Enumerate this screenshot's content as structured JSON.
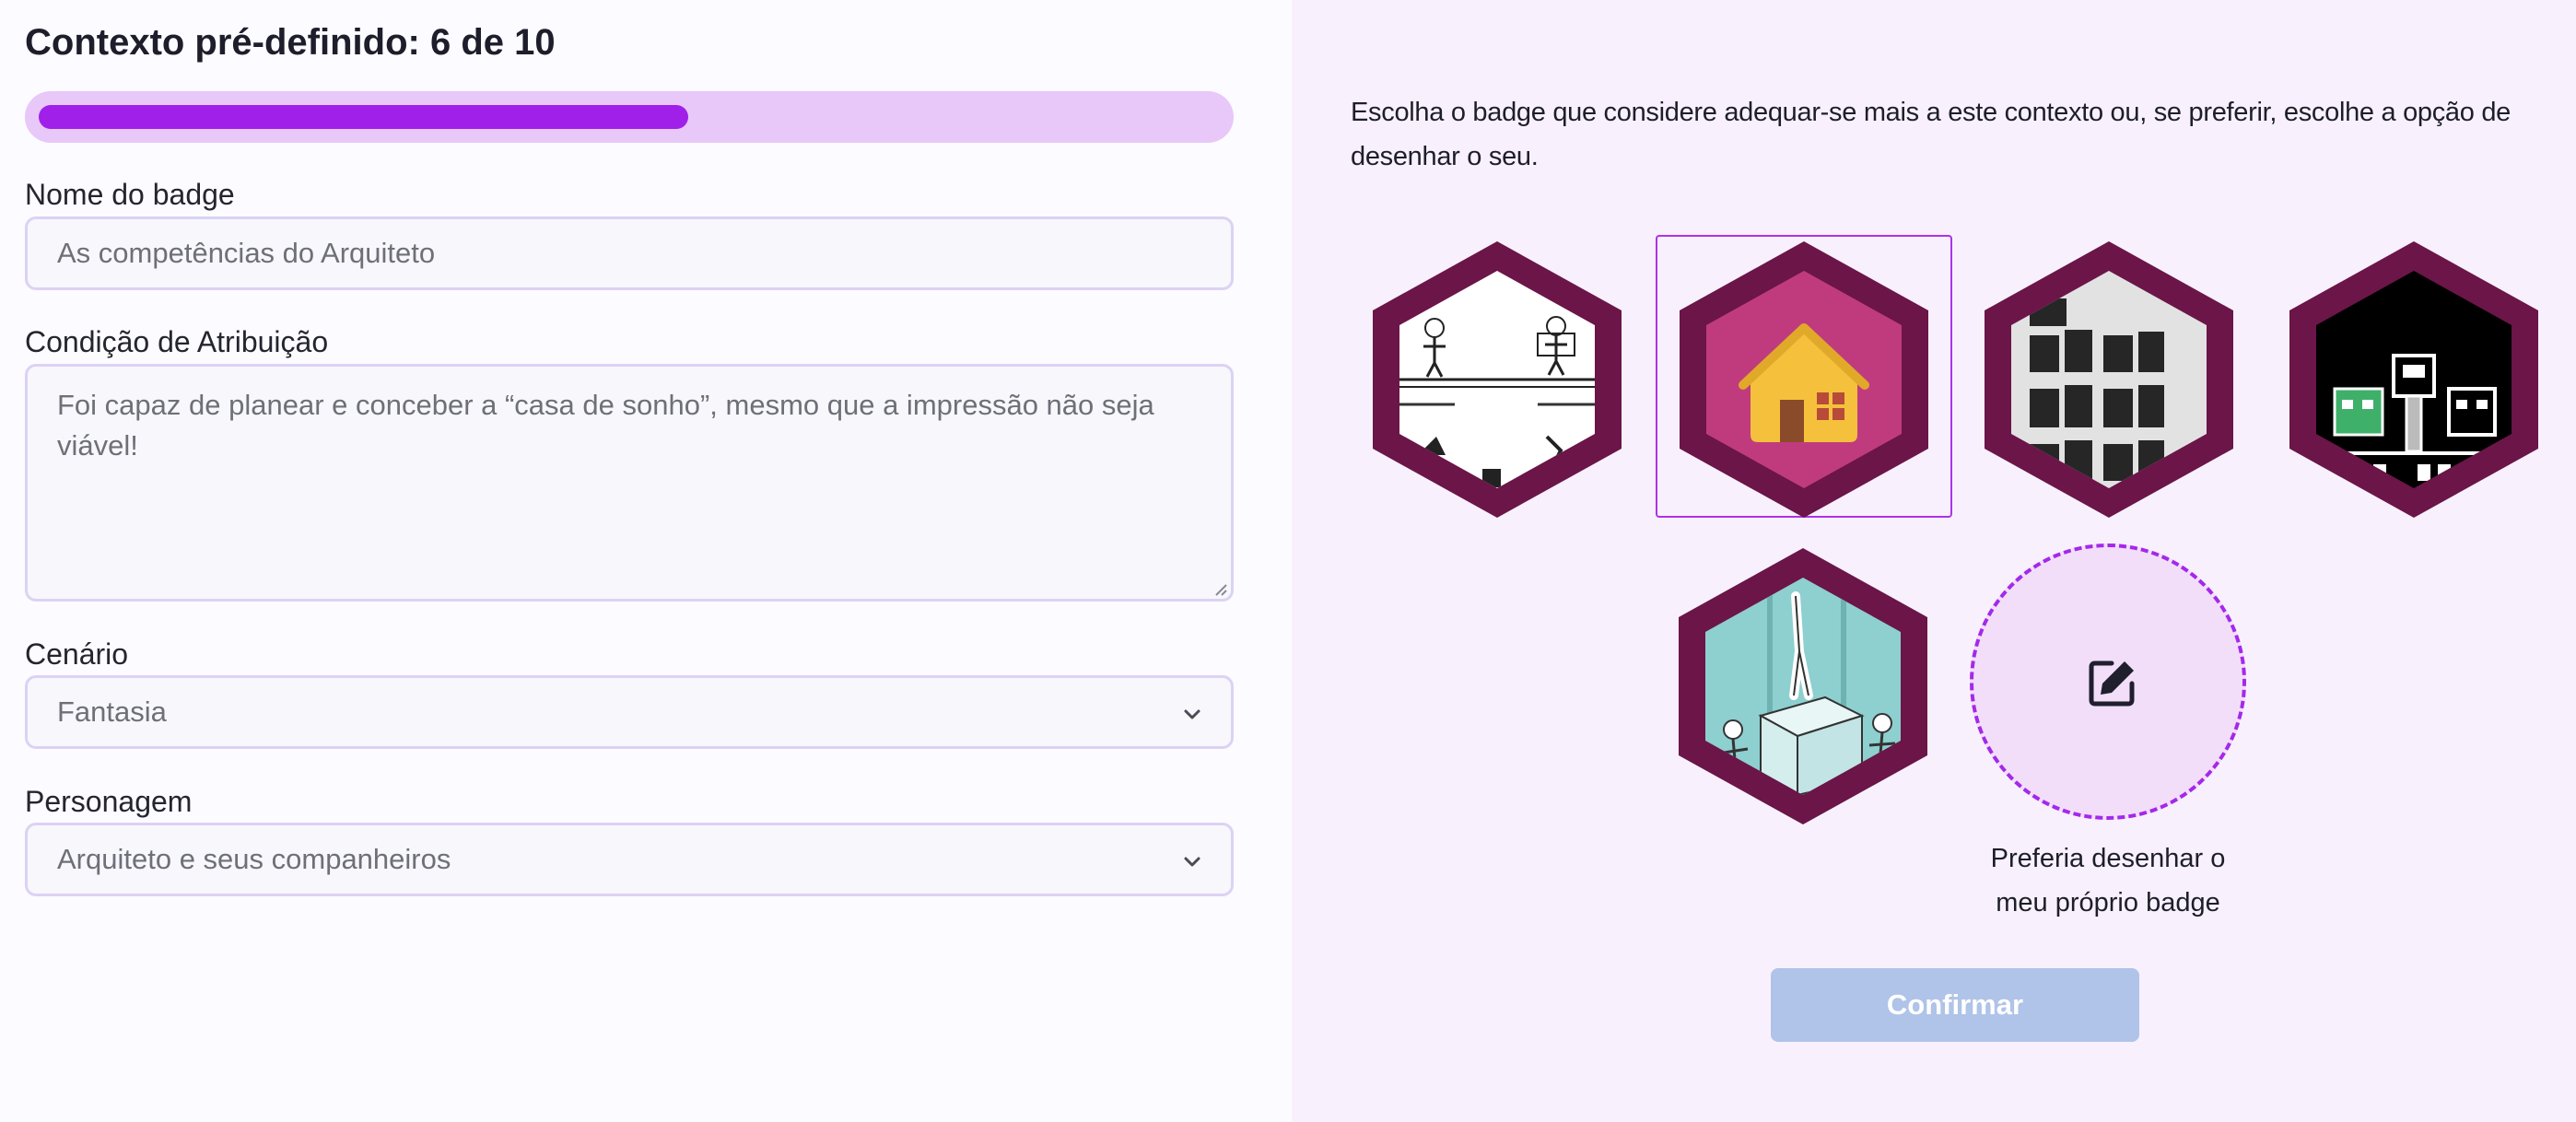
{
  "header": {
    "title": "Contexto pré-definido: 6 de 10",
    "progress": {
      "current": 6,
      "total": 10,
      "fraction": 0.6
    }
  },
  "form": {
    "badge_name": {
      "label": "Nome do badge",
      "value": "As competências do Arquiteto"
    },
    "condition": {
      "label": "Condição de Atribuição",
      "value": "Foi capaz de planear e conceber a “casa de sonho”, mesmo que a impressão não seja viável!"
    },
    "scenario": {
      "label": "Cenário",
      "value": "Fantasia"
    },
    "character": {
      "label": "Personagem",
      "value": "Arquiteto e seus companheiros"
    }
  },
  "chooser": {
    "prompt": "Escolha o badge que considere adequar-se mais a este contexto ou, se preferir, escolhe a opção de desenhar o seu.",
    "badges": [
      {
        "icon": "comic-sketch-icon"
      },
      {
        "icon": "house-icon",
        "selected": true
      },
      {
        "icon": "dark-blocks-icon"
      },
      {
        "icon": "pixel-robots-icon"
      },
      {
        "icon": "sketch-figures-icon"
      }
    ],
    "draw_own": {
      "icon": "edit-icon",
      "caption_line1": "Preferia desenhar o",
      "caption_line2": "meu próprio badge"
    },
    "confirm_label": "Confirmar"
  },
  "colors": {
    "accent": "#a020ea",
    "progress_track": "#e8c7f9",
    "hex_frame": "#6b1548",
    "confirm_disabled": "#b0c3e8"
  }
}
